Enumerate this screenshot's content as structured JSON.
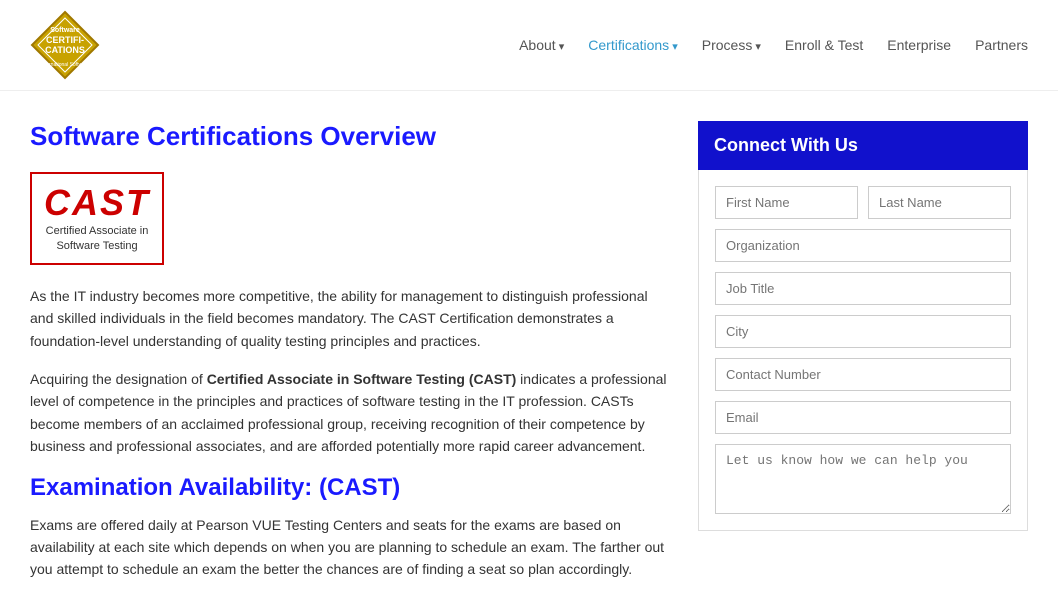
{
  "header": {
    "logo_text": "Software CERTIFICATIONS",
    "logo_subtext": "International Software Certification Board",
    "nav_items": [
      {
        "label": "About",
        "active": false,
        "has_arrow": true,
        "id": "about"
      },
      {
        "label": "Certifications",
        "active": true,
        "has_arrow": true,
        "id": "certifications"
      },
      {
        "label": "Process",
        "active": false,
        "has_arrow": true,
        "id": "process"
      },
      {
        "label": "Enroll & Test",
        "active": false,
        "has_arrow": false,
        "id": "enroll-test"
      },
      {
        "label": "Enterprise",
        "active": false,
        "has_arrow": false,
        "id": "enterprise"
      },
      {
        "label": "Partners",
        "active": false,
        "has_arrow": false,
        "id": "partners"
      }
    ]
  },
  "main": {
    "page_title": "Software Certifications Overview",
    "cast_logo": "CAST",
    "cast_subtext": "Certified Associate in\nSoftware Testing",
    "paragraph1": "As the IT industry becomes more competitive, the ability for management to distinguish professional and skilled individuals in the field becomes mandatory. The CAST Certification demonstrates a foundation-level understanding of quality testing principles and practices.",
    "paragraph2_prefix": "Acquiring the designation of ",
    "paragraph2_bold": "Certified Associate in Software Testing (CAST)",
    "paragraph2_suffix": " indicates a professional level of competence in the principles and practices of software testing in the IT profession. CASTs become members of an acclaimed professional group, receiving recognition of their competence by business and professional associates, and are afforded potentially more rapid career advancement.",
    "section_title": "Examination Availability: (CAST)",
    "paragraph3": "Exams are offered daily at Pearson VUE Testing Centers and seats for the exams are based on availability at each site which depends on when you are planning to schedule an exam. The farther out you attempt to schedule an exam the better the chances are of finding a seat so plan accordingly."
  },
  "sidebar": {
    "connect_header": "Connect With Us",
    "form": {
      "first_name_placeholder": "First Name",
      "last_name_placeholder": "Last Name",
      "organization_placeholder": "Organization",
      "job_title_placeholder": "Job Title",
      "city_placeholder": "City",
      "contact_number_placeholder": "Contact Number",
      "email_placeholder": "Email",
      "message_placeholder": "Let us know how we can help you"
    }
  }
}
